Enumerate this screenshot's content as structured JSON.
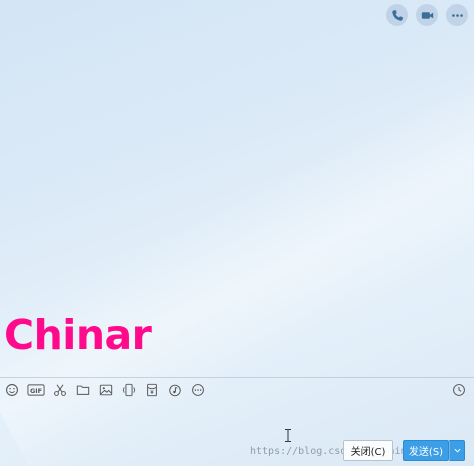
{
  "header": {
    "icons": [
      "phone-icon",
      "video-icon",
      "more-icon"
    ]
  },
  "message_area": {
    "overlay_text": "Chinar"
  },
  "toolbar": {
    "icons": [
      "emoji-icon",
      "gif-icon",
      "scissors-icon",
      "folder-icon",
      "image-icon",
      "shake-icon",
      "red-packet-icon",
      "music-icon",
      "more-options-icon"
    ],
    "gif_label": "GIF",
    "history_icon": "clock-icon"
  },
  "footer": {
    "watermark": "https://blog.csdn.net/ChinarCSDN",
    "close_label": "关闭(C)",
    "send_label": "发送(S)"
  },
  "colors": {
    "accent": "#3c9ee6",
    "overlay_text": "#ff0a8c"
  }
}
